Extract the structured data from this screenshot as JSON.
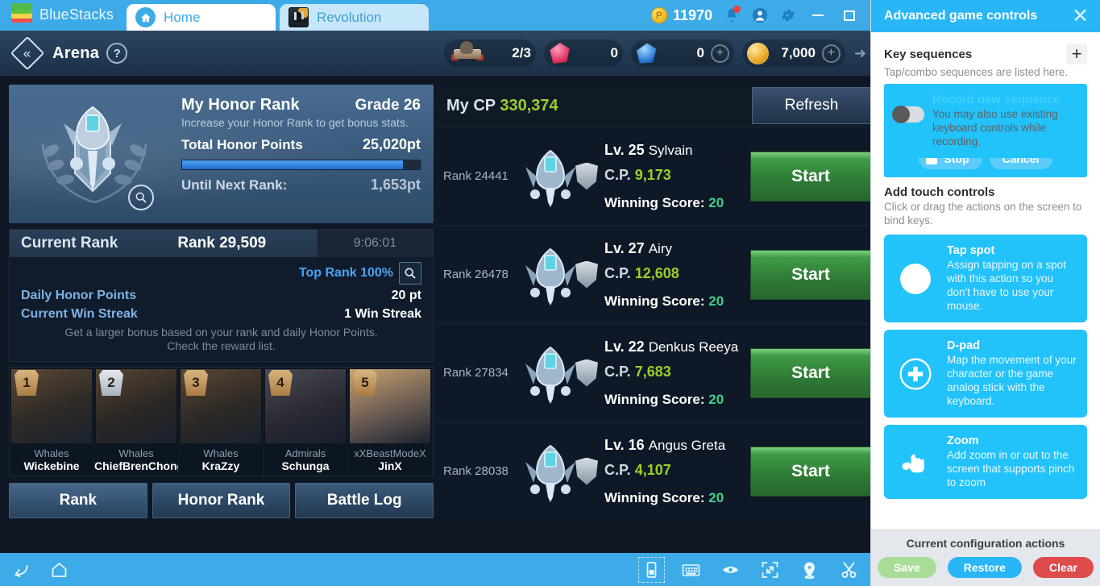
{
  "topbar": {
    "brand": "BlueStacks",
    "tabs": [
      {
        "label": "Home",
        "icon": "home-icon",
        "active": true
      },
      {
        "label": "Revolution",
        "icon": "app-icon",
        "active": false
      }
    ],
    "points": "11970",
    "point_symbol": "P",
    "icons": [
      "bell-icon",
      "account-icon",
      "gear-icon",
      "minimize-icon",
      "maximize-icon"
    ]
  },
  "game_header": {
    "back_icon": "back-chevron-icon",
    "title": "Arena",
    "help_label": "?",
    "resources": [
      {
        "icon": "arena-ticket-icon",
        "value": "2/3",
        "plus": false
      },
      {
        "icon": "red-gem-icon",
        "value": "0",
        "plus": false
      },
      {
        "icon": "blue-gem-icon",
        "value": "0",
        "plus": true
      },
      {
        "icon": "gold-coin-icon",
        "value": "7,000",
        "plus": true
      }
    ]
  },
  "honor": {
    "title": "My Honor Rank",
    "grade": "Grade 26",
    "subtitle": "Increase your Honor Rank to get bonus stats.",
    "total_label": "Total Honor Points",
    "total_value": "25,020pt",
    "progress_percent": 93,
    "next_label": "Until Next Rank:",
    "next_value": "1,653pt",
    "emblem_icon": "honor-emblem-icon",
    "magnifier_icon": "search-icon"
  },
  "current_rank": {
    "label": "Current Rank",
    "rank": "Rank 29,509",
    "timer": "9:06:01",
    "top_rank": "Top Rank 100%",
    "top_rank_icon": "search-icon",
    "rows": [
      {
        "key": "Daily Honor Points",
        "value": "20  pt"
      },
      {
        "key": "Current Win Streak",
        "value": "1  Win Streak"
      }
    ],
    "hint_line1": "Get a larger bonus based on your rank and daily Honor Points.",
    "hint_line2": "Check the reward list."
  },
  "top_players": [
    {
      "rank": "1",
      "guild": "Whales",
      "name": "Wickebine"
    },
    {
      "rank": "2",
      "guild": "Whales",
      "name": "ChiefBrenChong"
    },
    {
      "rank": "3",
      "guild": "Whales",
      "name": "KraZzy"
    },
    {
      "rank": "4",
      "guild": "Admirals",
      "name": "Schunga"
    },
    {
      "rank": "5",
      "guild": "xXBeastModeX",
      "name": "JinX"
    }
  ],
  "bottom_tabs": [
    {
      "label": "Rank",
      "selected": true
    },
    {
      "label": "Honor Rank",
      "selected": false
    },
    {
      "label": "Battle Log",
      "selected": false
    }
  ],
  "opponents_panel": {
    "my_cp_label": "My CP",
    "my_cp_value": "330,374",
    "refresh_label": "Refresh",
    "cp_prefix": "C.P.",
    "winning_score_label": "Winning Score:",
    "start_label": "Start",
    "rows": [
      {
        "rank": "Rank 24441",
        "level": "Lv. 25",
        "name": "Sylvain",
        "cp": "9,173",
        "winning_score": "20"
      },
      {
        "rank": "Rank 26478",
        "level": "Lv. 27",
        "name": "Airy",
        "cp": "12,608",
        "winning_score": "20"
      },
      {
        "rank": "Rank 27834",
        "level": "Lv. 22",
        "name": "Denkus Reeya",
        "cp": "7,683",
        "winning_score": "20"
      },
      {
        "rank": "Rank 28038",
        "level": "Lv. 16",
        "name": "Angus Greta",
        "cp": "4,107",
        "winning_score": "20"
      }
    ]
  },
  "bottom_toolbar": {
    "left_icons": [
      "back-arrow-icon",
      "home-icon"
    ],
    "right_icons": [
      "game-controls-icon",
      "keyboard-icon",
      "eye-icon",
      "fullscreen-icon",
      "location-pin-icon",
      "scissors-icon"
    ]
  },
  "sidebar": {
    "title": "Advanced game controls",
    "close_icon": "close-icon",
    "key_sequences": {
      "title": "Key sequences",
      "subtitle": "Tap/combo sequences are listed here.",
      "add_icon": "plus-icon",
      "record_card": {
        "title": "Record new sequence",
        "description": "You may also use existing keyboard controls while recording.",
        "stop_label": "Stop",
        "cancel_label": "Cancel",
        "toggle_icon": "toggle-switch-icon"
      }
    },
    "touch_controls": {
      "title": "Add touch controls",
      "subtitle": "Click or drag the actions on the screen to bind keys.",
      "cards": [
        {
          "icon": "tap-spot-icon",
          "title": "Tap spot",
          "description": "Assign tapping on a spot with this action so you don't have to use your mouse."
        },
        {
          "icon": "dpad-icon",
          "title": "D-pad",
          "description": "Map the movement of your character or the game analog stick with the keyboard."
        },
        {
          "icon": "zoom-pinch-icon",
          "title": "Zoom",
          "description": "Add zoom in or out to the screen that supports pinch to zoom"
        }
      ]
    },
    "footer": {
      "title": "Current configuration actions",
      "buttons": [
        {
          "label": "Save",
          "color": "#a9dc96"
        },
        {
          "label": "Restore",
          "color": "#29b6f6"
        },
        {
          "label": "Clear",
          "color": "#dd4b4b"
        }
      ]
    }
  }
}
